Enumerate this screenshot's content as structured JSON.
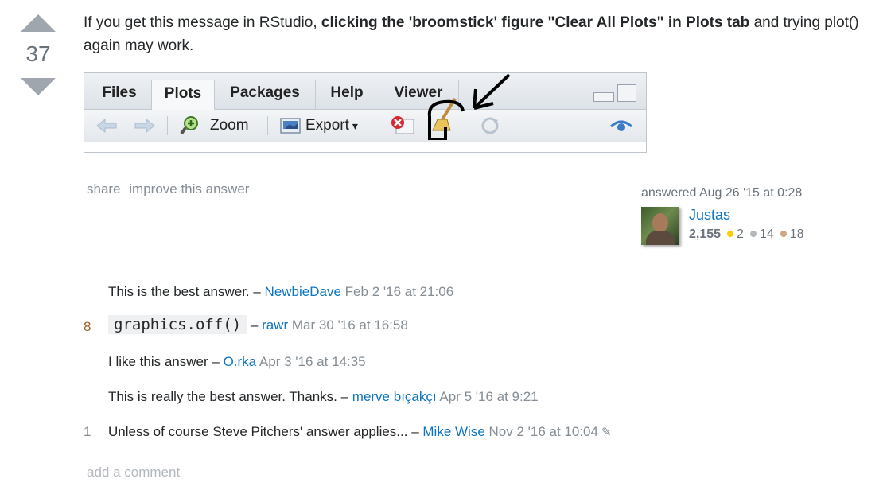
{
  "vote": {
    "count": "37"
  },
  "post": {
    "text_before": "If you get this message in RStudio, ",
    "text_bold": "clicking the 'broomstick' figure \"Clear All Plots\" in Plots tab",
    "text_after": " and trying plot() again may work."
  },
  "rstudio": {
    "tabs": [
      "Files",
      "Plots",
      "Packages",
      "Help",
      "Viewer"
    ],
    "active_tab": "Plots",
    "zoom_label": "Zoom",
    "export_label": "Export",
    "export_caret": "▾"
  },
  "post_menu": {
    "share": "share",
    "improve": "improve this answer"
  },
  "user_info": {
    "answered": "answered Aug 26 '15 at 0:28",
    "name": "Justas",
    "reputation": "2,155",
    "gold": "2",
    "silver": "14",
    "bronze": "18",
    "gold_color": "#ffcc01",
    "silver_color": "#b4b8bc",
    "bronze_color": "#d1a684"
  },
  "comments": [
    {
      "score": "",
      "text": "This is the best answer. – ",
      "user": "NewbieDave",
      "date": "Feb 2 '16 at 21:06"
    },
    {
      "score": "8",
      "code": "graphics.off()",
      "text": " – ",
      "user": "rawr",
      "date": "Mar 30 '16 at 16:58"
    },
    {
      "score": "",
      "text": "I like this answer – ",
      "user": "O.rka",
      "date": "Apr 3 '16 at 14:35"
    },
    {
      "score": "",
      "text": "This is really the best answer. Thanks. – ",
      "user": "merve bıçakçı",
      "date": "Apr 5 '16 at 9:21"
    },
    {
      "score": "1",
      "text": "Unless of course Steve Pitchers' answer applies... – ",
      "user": "Mike Wise",
      "date": "Nov 2 '16 at 10:04",
      "edited": true
    }
  ],
  "add_comment": "add a comment"
}
